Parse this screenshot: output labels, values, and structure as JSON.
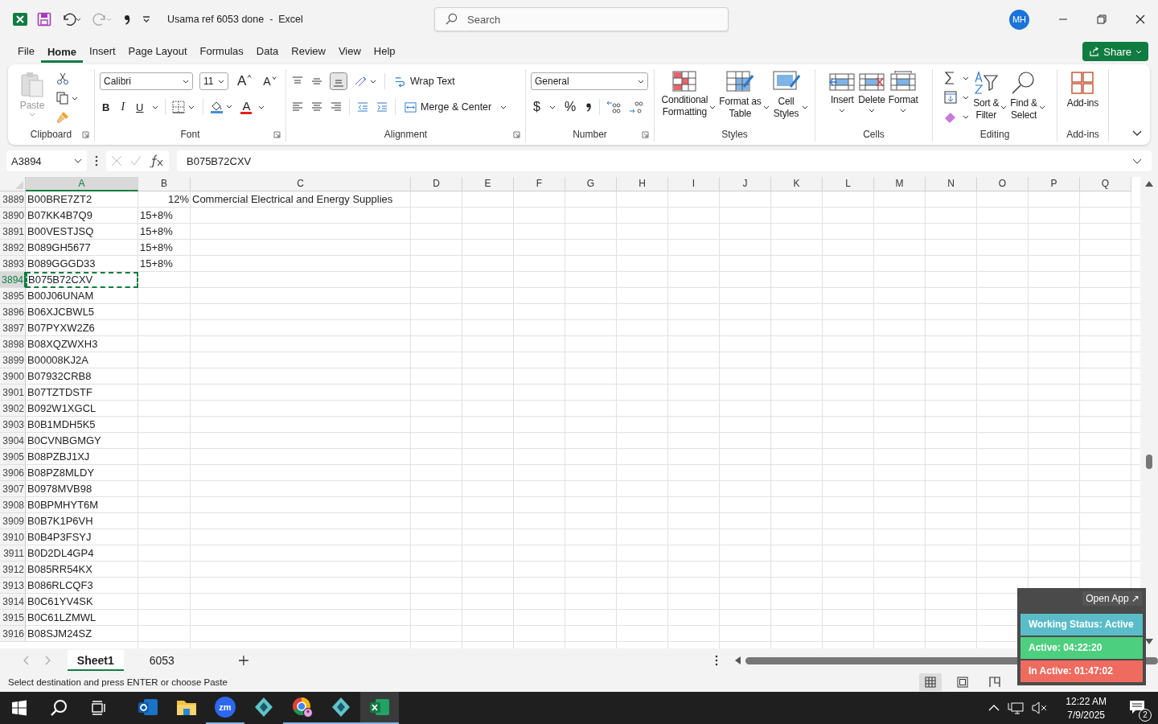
{
  "window": {
    "title": "Usama ref 6053 done  -  Excel"
  },
  "search": {
    "placeholder": "Search"
  },
  "account": {
    "initials": "MH"
  },
  "menu_tabs": [
    {
      "label": "File",
      "selected": false
    },
    {
      "label": "Home",
      "selected": true
    },
    {
      "label": "Insert",
      "selected": false
    },
    {
      "label": "Page Layout",
      "selected": false
    },
    {
      "label": "Formulas",
      "selected": false
    },
    {
      "label": "Data",
      "selected": false
    },
    {
      "label": "Review",
      "selected": false
    },
    {
      "label": "View",
      "selected": false
    },
    {
      "label": "Help",
      "selected": false
    }
  ],
  "share": {
    "label": "Share"
  },
  "ribbon": {
    "clipboard": {
      "label": "Clipboard",
      "paste": "Paste"
    },
    "font": {
      "label": "Font",
      "font_name": "Calibri",
      "font_size": "11",
      "grow": "A",
      "shrink": "A",
      "bold": "B",
      "italic": "I",
      "underline": "U",
      "font_color": "A"
    },
    "alignment": {
      "label": "Alignment",
      "wrap_text": "Wrap Text",
      "merge": "Merge & Center"
    },
    "number": {
      "label": "Number",
      "format": "General",
      "currency": "$",
      "percent": "%"
    },
    "styles": {
      "label": "Styles",
      "buttons": [
        "Conditional\nFormatting",
        "Format as\nTable",
        "Cell\nStyles"
      ]
    },
    "cells": {
      "label": "Cells",
      "buttons": [
        "Insert",
        "Delete",
        "Format"
      ]
    },
    "editing": {
      "label": "Editing",
      "buttons": [
        "Sort &\nFilter",
        "Find &\nSelect"
      ]
    },
    "addins": {
      "label": "Add-ins",
      "button": "Add-ins"
    }
  },
  "formula_bar": {
    "name_box": "A3894",
    "formula": "B075B72CXV"
  },
  "columns": [
    {
      "label": "A",
      "selected": true
    },
    {
      "label": "B",
      "selected": false
    },
    {
      "label": "C",
      "selected": false
    },
    {
      "label": "D",
      "selected": false
    },
    {
      "label": "E",
      "selected": false
    },
    {
      "label": "F",
      "selected": false
    },
    {
      "label": "G",
      "selected": false
    },
    {
      "label": "H",
      "selected": false
    },
    {
      "label": "I",
      "selected": false
    },
    {
      "label": "J",
      "selected": false
    },
    {
      "label": "K",
      "selected": false
    },
    {
      "label": "L",
      "selected": false
    },
    {
      "label": "M",
      "selected": false
    },
    {
      "label": "N",
      "selected": false
    },
    {
      "label": "O",
      "selected": false
    },
    {
      "label": "P",
      "selected": false
    },
    {
      "label": "Q",
      "selected": false
    }
  ],
  "rows": [
    {
      "number": "3889",
      "selected": false,
      "cells": [
        {
          "text": "B00BRE7ZT2",
          "numeric": false
        },
        {
          "text": "12%",
          "numeric": true
        },
        {
          "text": "Commercial Electrical and Energy Supplies",
          "numeric": false
        }
      ]
    },
    {
      "number": "3890",
      "selected": false,
      "cells": [
        {
          "text": "B07KK4B7Q9",
          "numeric": false
        },
        {
          "text": "15+8%",
          "numeric": false
        }
      ]
    },
    {
      "number": "3891",
      "selected": false,
      "cells": [
        {
          "text": "B00VESTJSQ",
          "numeric": false
        },
        {
          "text": "15+8%",
          "numeric": false
        }
      ]
    },
    {
      "number": "3892",
      "selected": false,
      "cells": [
        {
          "text": "B089GH5677",
          "numeric": false
        },
        {
          "text": "15+8%",
          "numeric": false
        }
      ]
    },
    {
      "number": "3893",
      "selected": false,
      "cells": [
        {
          "text": "B089GGGD33",
          "numeric": false
        },
        {
          "text": "15+8%",
          "numeric": false
        }
      ]
    },
    {
      "number": "3894",
      "selected": true,
      "cells": [
        {
          "text": "B075B72CXV",
          "numeric": false
        }
      ]
    },
    {
      "number": "3895",
      "selected": false,
      "cells": [
        {
          "text": "B00J06UNAM",
          "numeric": false
        }
      ]
    },
    {
      "number": "3896",
      "selected": false,
      "cells": [
        {
          "text": "B06XJCBWL5",
          "numeric": false
        }
      ]
    },
    {
      "number": "3897",
      "selected": false,
      "cells": [
        {
          "text": "B07PYXW2Z6",
          "numeric": false
        }
      ]
    },
    {
      "number": "3898",
      "selected": false,
      "cells": [
        {
          "text": "B08XQZWXH3",
          "numeric": false
        }
      ]
    },
    {
      "number": "3899",
      "selected": false,
      "cells": [
        {
          "text": "B00008KJ2A",
          "numeric": false
        }
      ]
    },
    {
      "number": "3900",
      "selected": false,
      "cells": [
        {
          "text": "B07932CRB8",
          "numeric": false
        }
      ]
    },
    {
      "number": "3901",
      "selected": false,
      "cells": [
        {
          "text": "B07TZTDSTF",
          "numeric": false
        }
      ]
    },
    {
      "number": "3902",
      "selected": false,
      "cells": [
        {
          "text": "B092W1XGCL",
          "numeric": false
        }
      ]
    },
    {
      "number": "3903",
      "selected": false,
      "cells": [
        {
          "text": "B0B1MDH5K5",
          "numeric": false
        }
      ]
    },
    {
      "number": "3904",
      "selected": false,
      "cells": [
        {
          "text": "B0CVNBGMGY",
          "numeric": false
        }
      ]
    },
    {
      "number": "3905",
      "selected": false,
      "cells": [
        {
          "text": "B08PZBJ1XJ",
          "numeric": false
        }
      ]
    },
    {
      "number": "3906",
      "selected": false,
      "cells": [
        {
          "text": "B08PZ8MLDY",
          "numeric": false
        }
      ]
    },
    {
      "number": "3907",
      "selected": false,
      "cells": [
        {
          "text": "B0978MVB98",
          "numeric": false
        }
      ]
    },
    {
      "number": "3908",
      "selected": false,
      "cells": [
        {
          "text": "B0BPMHYT6M",
          "numeric": false
        }
      ]
    },
    {
      "number": "3909",
      "selected": false,
      "cells": [
        {
          "text": "B0B7K1P6VH",
          "numeric": false
        }
      ]
    },
    {
      "number": "3910",
      "selected": false,
      "cells": [
        {
          "text": "B0B4P3FSYJ",
          "numeric": false
        }
      ]
    },
    {
      "number": "3911",
      "selected": false,
      "cells": [
        {
          "text": "B0D2DL4GP4",
          "numeric": false
        }
      ]
    },
    {
      "number": "3912",
      "selected": false,
      "cells": [
        {
          "text": "B085RR54KX",
          "numeric": false
        }
      ]
    },
    {
      "number": "3913",
      "selected": false,
      "cells": [
        {
          "text": "B086RLCQF3",
          "numeric": false
        }
      ]
    },
    {
      "number": "3914",
      "selected": false,
      "cells": [
        {
          "text": "B0C61YV4SK",
          "numeric": false
        }
      ]
    },
    {
      "number": "3915",
      "selected": false,
      "cells": [
        {
          "text": "B0C61LZMWL",
          "numeric": false
        }
      ]
    },
    {
      "number": "3916",
      "selected": false,
      "cells": [
        {
          "text": "B08SJM24SZ",
          "numeric": false
        }
      ]
    }
  ],
  "sheet_tabs": [
    {
      "label": "Sheet1",
      "selected": true
    },
    {
      "label": "6053",
      "selected": false
    }
  ],
  "status_bar": {
    "message": "Select destination and press ENTER or choose Paste",
    "views": [
      {
        "selected": true
      },
      {
        "selected": false
      },
      {
        "selected": false
      }
    ]
  },
  "tracker": {
    "open_app": "Open App ↗",
    "statuses": [
      {
        "label": "Working Status: Active",
        "color": "#5bbcc9"
      },
      {
        "label": "Active: 04:22:20",
        "color": "#4ccf7e"
      },
      {
        "label": "In Active: 01:47:02",
        "color": "#ef6b5f"
      }
    ]
  },
  "taskbar": {
    "apps": [
      {
        "running": false,
        "selected": false
      },
      {
        "running": false,
        "selected": false
      },
      {
        "running": true,
        "selected": false,
        "label": "zm"
      },
      {
        "running": false,
        "selected": false
      },
      {
        "running": true,
        "selected": false
      },
      {
        "running": true,
        "selected": false
      },
      {
        "running": true,
        "selected": true
      }
    ],
    "time": "12:22 AM",
    "date": "7/9/2025",
    "notifications": "2"
  }
}
